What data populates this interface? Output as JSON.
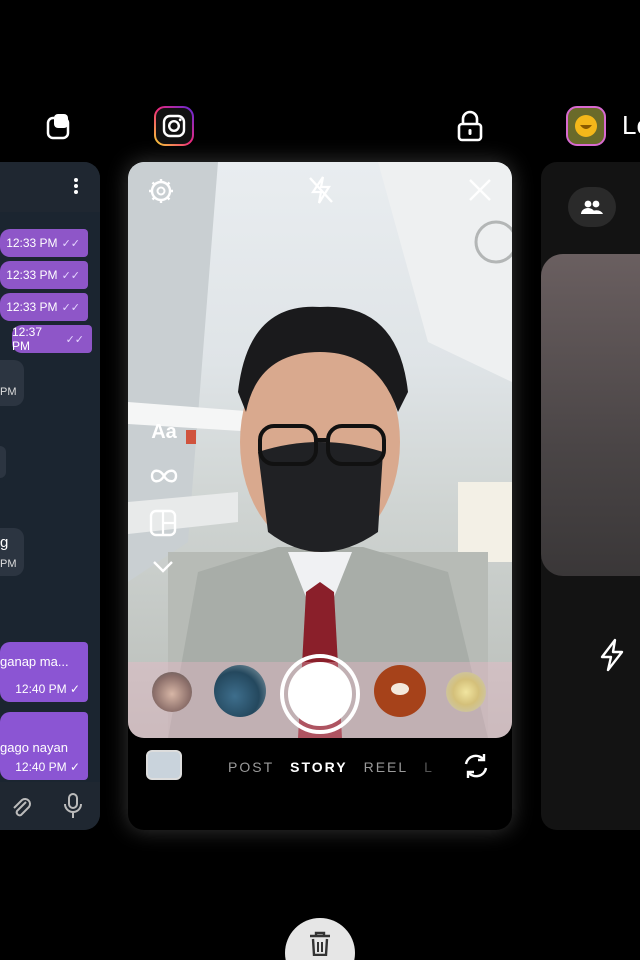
{
  "recents": {
    "top_icons": [
      "multi-window-icon",
      "instagram-app-icon",
      "lock-icon",
      "app-icon"
    ],
    "right_app_label": "Le"
  },
  "chat": {
    "outgoing": [
      {
        "time": "12:33 PM"
      },
      {
        "time": "12:33 PM"
      },
      {
        "time": "12:33 PM"
      },
      {
        "time": "12:37 PM"
      }
    ],
    "incoming_fragments": [
      {
        "line1": "",
        "line2": "PM"
      },
      {
        "line1": "g",
        "line2": "PM"
      }
    ],
    "outgoing_long": [
      {
        "text": "ganap ma...",
        "time": "12:40 PM"
      },
      {
        "text": "gago nayan",
        "time": "12:40 PM"
      }
    ]
  },
  "camera": {
    "left_tools": {
      "text_tool": "Aa"
    },
    "modes": [
      "POST",
      "STORY",
      "REEL",
      "L"
    ],
    "active_mode": "STORY",
    "accent_color": "#ffffff"
  }
}
